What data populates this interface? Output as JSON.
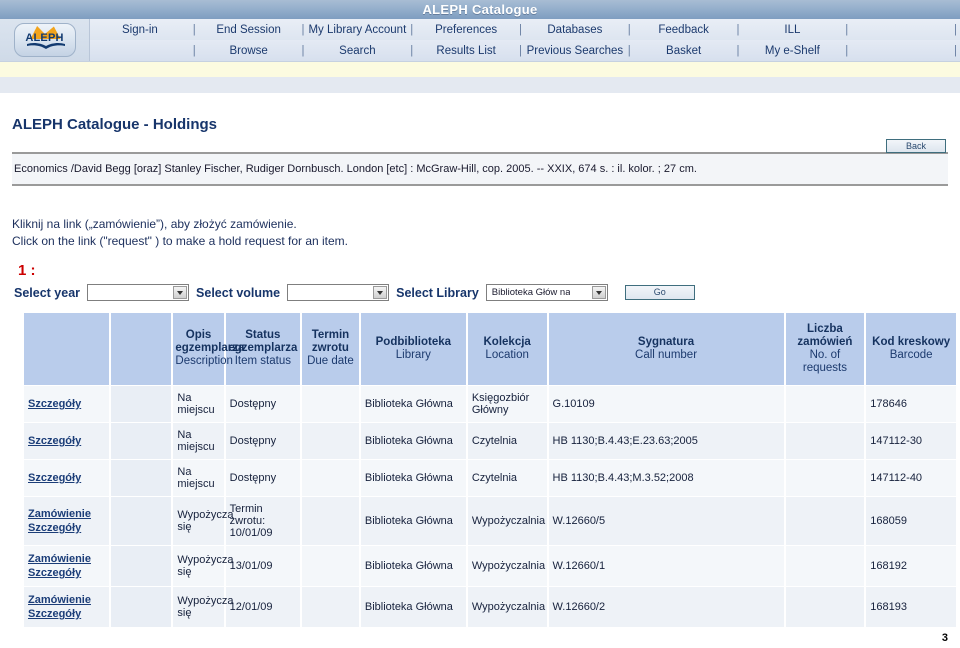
{
  "banner": {
    "title": "ALEPH  Catalogue"
  },
  "nav": {
    "row1": [
      "Sign-in",
      "End Session",
      "My Library Account",
      "Preferences",
      "Databases",
      "Feedback",
      "ILL",
      ""
    ],
    "row2": [
      "",
      "Browse",
      "Search",
      "Results List",
      "Previous Searches",
      "Basket",
      "My e-Shelf",
      ""
    ],
    "separator": "|",
    "logo_text": "ALEPH"
  },
  "page": {
    "title": "ALEPH Catalogue - Holdings",
    "back_label": "Back",
    "bibliographic_record": "Economics /David Begg [oraz] Stanley Fischer, Rudiger Dornbusch. London [etc] : McGraw-Hill, cop. 2005. --  XXIX, 674 s. : il. kolor. ; 27 cm.",
    "instruction_pl": "Kliknij na link  („zamówienie”), aby złożyć zamówienie.",
    "instruction_en": "Click on the link (\"request\" ) to make a hold request  for an item.",
    "sequence_number": "1 :",
    "page_number": "3"
  },
  "filters": {
    "year_label": "Select year",
    "year_value": "",
    "volume_label": "Select volume",
    "volume_value": "",
    "library_label": "Select Library",
    "library_value": "Biblioteka Głów na",
    "go_label": "Go"
  },
  "table": {
    "headers": [
      {
        "pl": "",
        "en": ""
      },
      {
        "pl": "",
        "en": ""
      },
      {
        "pl": "Opis egzemplarza",
        "en": "Description"
      },
      {
        "pl": "Status egzemplarza",
        "en": "Item status"
      },
      {
        "pl": "Termin zwrotu",
        "en": "Due date"
      },
      {
        "pl": "Podbiblioteka",
        "en": "Library"
      },
      {
        "pl": "Kolekcja",
        "en": "Location"
      },
      {
        "pl": "Sygnatura",
        "en": "Call number"
      },
      {
        "pl": "Liczba zamówień",
        "en": "No. of requests"
      },
      {
        "pl": "Kod kreskowy",
        "en": "Barcode"
      }
    ],
    "rows": [
      {
        "links": [
          "Szczegóły"
        ],
        "blank": "",
        "description": "Na miejscu",
        "item_status": "Dostępny",
        "due_date": "",
        "library": "Biblioteka Główna",
        "location": "Księgozbiór Główny",
        "call_number": "G.10109",
        "requests": "",
        "barcode": "178646"
      },
      {
        "links": [
          "Szczegóły"
        ],
        "blank": "",
        "description": "Na miejscu",
        "item_status": "Dostępny",
        "due_date": "",
        "library": "Biblioteka Główna",
        "location": "Czytelnia",
        "call_number": "HB 1130;B.4.43;E.23.63;2005",
        "requests": "",
        "barcode": "147112-30"
      },
      {
        "links": [
          "Szczegóły"
        ],
        "blank": "",
        "description": "Na miejscu",
        "item_status": "Dostępny",
        "due_date": "",
        "library": "Biblioteka Główna",
        "location": "Czytelnia",
        "call_number": "HB 1130;B.4.43;M.3.52;2008",
        "requests": "",
        "barcode": "147112-40"
      },
      {
        "links": [
          "Zamówienie",
          "Szczegóły"
        ],
        "blank": "",
        "description": "Wypożycza się",
        "item_status": "Termin zwrotu: 10/01/09",
        "due_date": "",
        "library": "Biblioteka Główna",
        "location": "Wypożyczalnia",
        "call_number": "W.12660/5",
        "requests": "",
        "barcode": "168059"
      },
      {
        "links": [
          "Zamówienie",
          "Szczegóły"
        ],
        "blank": "",
        "description": "Wypożycza się",
        "item_status": "13/01/09",
        "due_date": "",
        "library": "Biblioteka Główna",
        "location": "Wypożyczalnia",
        "call_number": "W.12660/1",
        "requests": "",
        "barcode": "168192"
      },
      {
        "links": [
          "Zamówienie",
          "Szczegóły"
        ],
        "blank": "",
        "description": "Wypożycza się",
        "item_status": "12/01/09",
        "due_date": "",
        "library": "Biblioteka Główna",
        "location": "Wypożyczalnia",
        "call_number": "W.12660/2",
        "requests": "",
        "barcode": "168193"
      }
    ]
  },
  "colors": {
    "banner": "#93aecb",
    "header_cell": "#b9cceb",
    "title_blue": "#17356b",
    "seq_red": "#cc0000",
    "status_green": "#1f7a33",
    "location_red": "#d42020",
    "logo_orange": "#f2a41c"
  }
}
